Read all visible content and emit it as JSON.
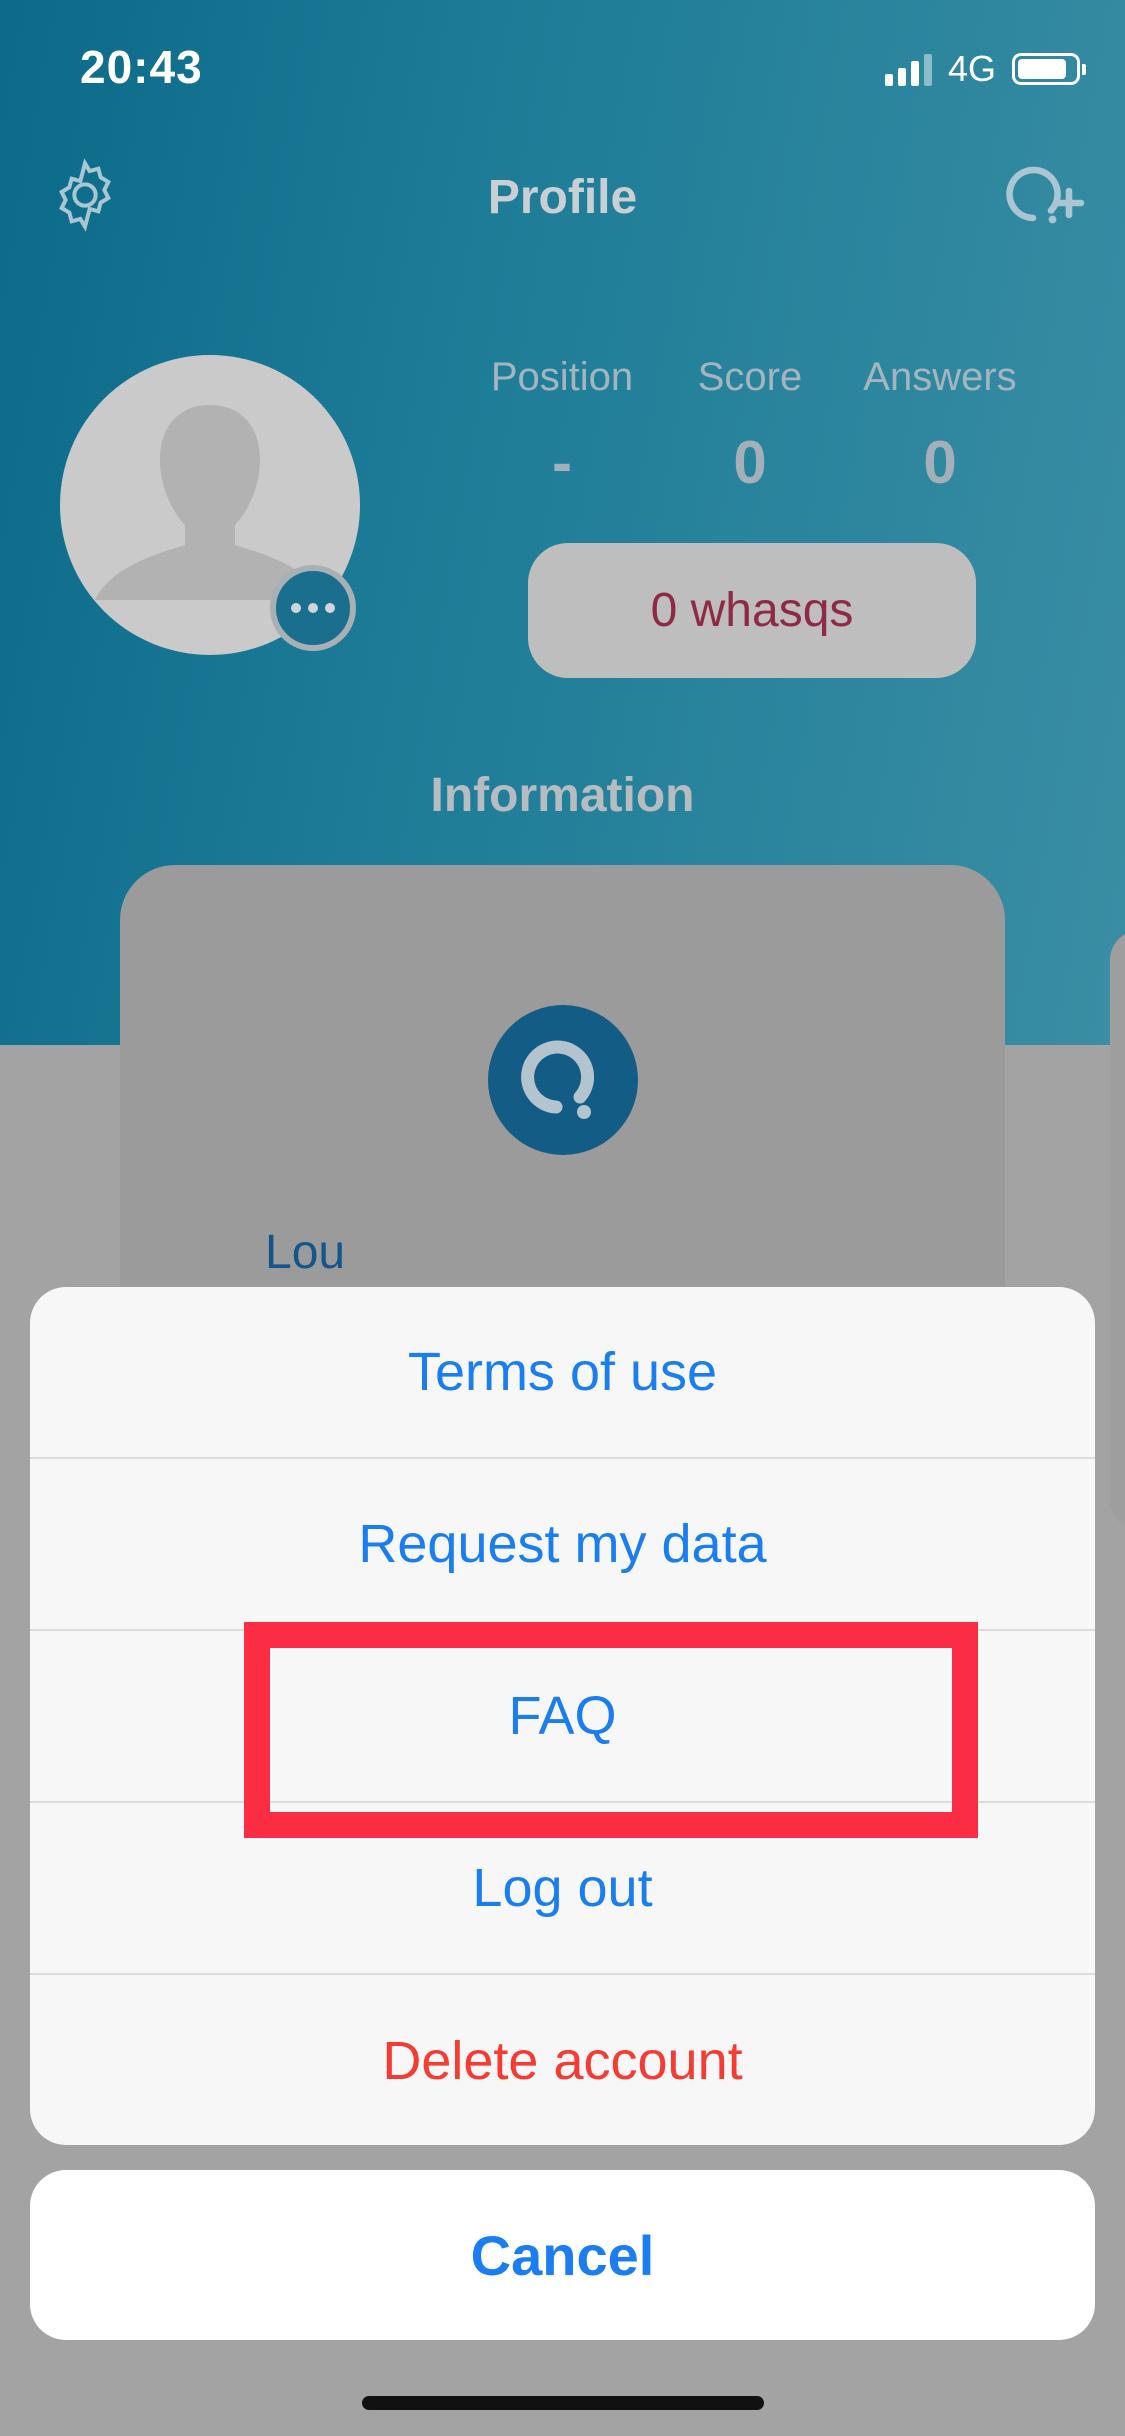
{
  "status_bar": {
    "time": "20:43",
    "network": "4G",
    "battery_level": 0.85
  },
  "nav": {
    "title": "Profile",
    "left_icon": "gear-icon",
    "right_icon": "add-question-icon"
  },
  "stats": [
    {
      "label": "Position",
      "value": "-"
    },
    {
      "label": "Score",
      "value": "0"
    },
    {
      "label": "Answers",
      "value": "0"
    }
  ],
  "whasqs_button": "0 whasqs",
  "section_title": "Information",
  "card": {
    "name": "Lou",
    "logo_icon": "whasq-logo-icon"
  },
  "action_sheet": {
    "items": [
      {
        "label": "Terms of use",
        "style": "default"
      },
      {
        "label": "Request my data",
        "style": "default"
      },
      {
        "label": "FAQ",
        "style": "default",
        "highlighted": true
      },
      {
        "label": "Log out",
        "style": "default"
      },
      {
        "label": "Delete account",
        "style": "destructive"
      }
    ],
    "cancel_label": "Cancel"
  },
  "colors": {
    "action_blue": "#1a7df2",
    "destructive_red": "#f53b32",
    "highlight_red": "#fb2d45",
    "header_teal": "#1d7c97"
  }
}
